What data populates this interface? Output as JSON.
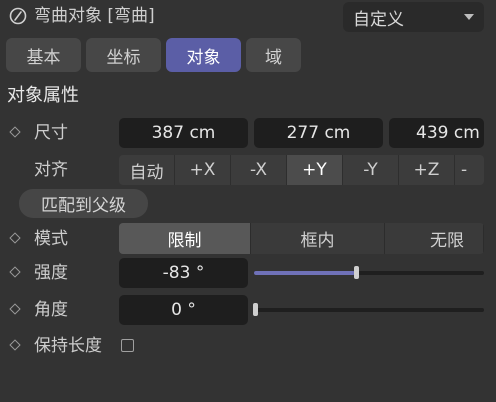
{
  "header": {
    "title": "弯曲对象 [弯曲]",
    "icon": "bend-object-icon",
    "preset": "自定义"
  },
  "tabs": [
    {
      "label": "基本",
      "active": false
    },
    {
      "label": "坐标",
      "active": false
    },
    {
      "label": "对象",
      "active": true
    },
    {
      "label": "域",
      "active": false
    }
  ],
  "section_title": "对象属性",
  "size": {
    "label": "尺寸",
    "x": "387 cm",
    "y": "277 cm",
    "z": "439 cm"
  },
  "align": {
    "label": "对齐",
    "options": [
      "自动",
      "+X",
      "-X",
      "+Y",
      "-Y",
      "+Z",
      "-"
    ],
    "selected": "+Y"
  },
  "fit_parent_button": "匹配到父级",
  "mode": {
    "label": "模式",
    "options": [
      "限制",
      "框内",
      "无限"
    ],
    "selected": "限制"
  },
  "strength": {
    "label": "强度",
    "value": "-83 °",
    "slider_fraction": 0.44
  },
  "angle": {
    "label": "角度",
    "value": "0 °",
    "slider_fraction": 0.0
  },
  "keep_length": {
    "label": "保持长度",
    "checked": false
  },
  "colors": {
    "background": "#333333",
    "accent": "#5b5ea6",
    "field": "#1e1e1e"
  }
}
